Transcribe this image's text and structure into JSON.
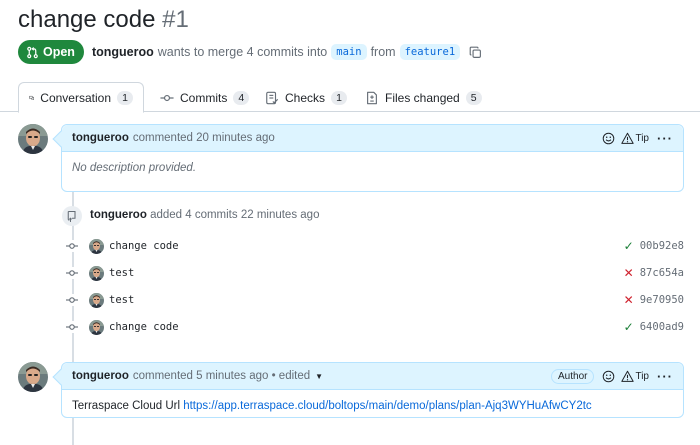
{
  "pr": {
    "title": "change code",
    "number": "#1",
    "state": "Open",
    "author": "tongueroo",
    "merge_text": "wants to merge 4 commits into",
    "base_branch": "main",
    "from_text": "from",
    "head_branch": "feature1"
  },
  "tabs": [
    {
      "label": "Conversation",
      "count": "1"
    },
    {
      "label": "Commits",
      "count": "4"
    },
    {
      "label": "Checks",
      "count": "1"
    },
    {
      "label": "Files changed",
      "count": "5"
    }
  ],
  "comments": [
    {
      "author": "tongueroo",
      "action": "commented 20 minutes ago",
      "tip": "Tip",
      "body": "No description provided."
    },
    {
      "author": "tongueroo",
      "action": "commented 5 minutes ago • edited",
      "author_label": "Author",
      "tip": "Tip",
      "body_text": "Terraspace Cloud Url",
      "body_link": "https://app.terraspace.cloud/boltops/main/demo/plans/plan-Ajq3WYHuAfwCY2tc"
    }
  ],
  "commit_event": {
    "author": "tongueroo",
    "action": "added 4 commits 22 minutes ago"
  },
  "commits": [
    {
      "message": "change code",
      "status": "success",
      "sha": "00b92e8"
    },
    {
      "message": "test",
      "status": "failure",
      "sha": "87c654a"
    },
    {
      "message": "test",
      "status": "failure",
      "sha": "9e70950"
    },
    {
      "message": "change code",
      "status": "success",
      "sha": "6400ad9"
    }
  ],
  "colors": {
    "open_green": "#1f883d",
    "link_blue": "#0969da",
    "comment_header": "#ddf4ff",
    "success": "#1a7f37",
    "failure": "#cf222e"
  }
}
